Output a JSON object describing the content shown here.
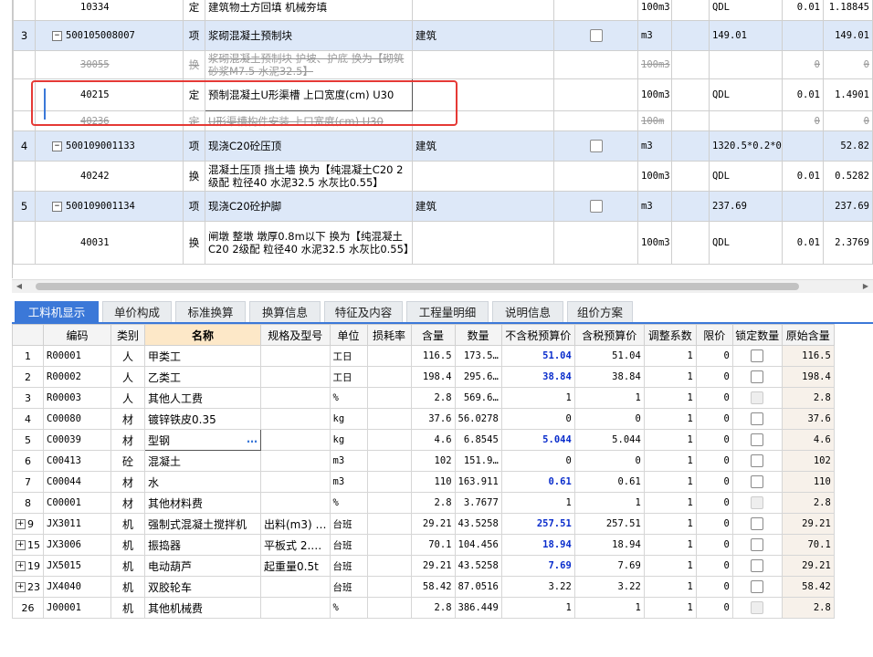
{
  "top_rows": [
    {
      "kind": "de",
      "seq": "",
      "code": "10334",
      "type": "定",
      "name": "建筑物土方回填 机械夯填",
      "spec": "",
      "unit": "100m3",
      "qty_expr": "QDL",
      "qty": "0.01",
      "total": "1.18845"
    },
    {
      "kind": "qd",
      "seq": "3",
      "code": "500105008007",
      "type": "项",
      "name": "浆砌混凝土预制块",
      "spec": "建筑",
      "unit": "m3",
      "qty_expr": "149.01",
      "qty": "",
      "total": "149.01"
    },
    {
      "kind": "strike",
      "seq": "",
      "code": "30055",
      "type": "换",
      "name": "浆砌混凝土预制块 护坡、护底  换为【砌筑砂浆M7.5 水泥32.5】",
      "spec": "",
      "unit": "100m3",
      "qty_expr": "",
      "qty": "0",
      "total": "0"
    },
    {
      "kind": "sel",
      "seq": "",
      "code": "40215",
      "type": "定",
      "name": "预制混凝土U形渠槽 上口宽度(cm) U30",
      "spec": "",
      "unit": "100m3",
      "qty_expr": "QDL",
      "qty": "0.01",
      "total": "1.4901",
      "extra": "2"
    },
    {
      "kind": "strike",
      "seq": "",
      "code": "40236",
      "type": "定",
      "name": "U形渠槽构件安装 上口宽度(cm) U30",
      "spec": "",
      "unit": "100m",
      "qty_expr": "",
      "qty": "0",
      "total": "0"
    },
    {
      "kind": "qd",
      "seq": "4",
      "code": "500109001133",
      "type": "项",
      "name": "现浇C20砼压顶",
      "spec": "建筑",
      "unit": "m3",
      "qty_expr": "1320.5*0.2*0.1*2",
      "qty": "",
      "total": "52.82"
    },
    {
      "kind": "de",
      "seq": "",
      "code": "40242",
      "type": "换",
      "name": "混凝土压顶 挡土墙  换为【纯混凝土C20 2级配 粒径40 水泥32.5 水灰比0.55】",
      "spec": "",
      "unit": "100m3",
      "qty_expr": "QDL",
      "qty": "0.01",
      "total": "0.5282",
      "extra": "4"
    },
    {
      "kind": "qd",
      "seq": "5",
      "code": "500109001134",
      "type": "项",
      "name": "现浇C20砼护脚",
      "spec": "建筑",
      "unit": "m3",
      "qty_expr": "237.69",
      "qty": "",
      "total": "237.69"
    },
    {
      "kind": "de",
      "seq": "",
      "code": "40031",
      "type": "换",
      "name": "闸墩 整墩 墩厚0.8m以下  换为【纯混凝土C20 2级配 粒径40 水泥32.5 水灰比0.55】",
      "spec": "",
      "unit": "100m3",
      "qty_expr": "QDL",
      "qty": "0.01",
      "total": "2.3769"
    }
  ],
  "tabs": [
    "工料机显示",
    "单价构成",
    "标准换算",
    "换算信息",
    "特征及内容",
    "工程量明细",
    "说明信息",
    "组价方案"
  ],
  "columns": [
    "编码",
    "类别",
    "名称",
    "规格及型号",
    "单位",
    "损耗率",
    "含量",
    "数量",
    "不含税预算价",
    "含税预算价",
    "调整系数",
    "限价",
    "锁定数量",
    "原始含量"
  ],
  "materials": [
    {
      "rn": "1",
      "expand": "",
      "code": "R00001",
      "cat": "人",
      "name": "甲类工",
      "spec": "",
      "unit": "工日",
      "loss": "",
      "content": "116.5",
      "qty": "173.5…",
      "price_ex": "51.04",
      "price_in": "51.04",
      "coef": "1",
      "limit": "0",
      "lock": "on",
      "orig": "116.5"
    },
    {
      "rn": "2",
      "expand": "",
      "code": "R00002",
      "cat": "人",
      "name": "乙类工",
      "spec": "",
      "unit": "工日",
      "loss": "",
      "content": "198.4",
      "qty": "295.6…",
      "price_ex": "38.84",
      "price_in": "38.84",
      "coef": "1",
      "limit": "0",
      "lock": "on",
      "orig": "198.4"
    },
    {
      "rn": "3",
      "expand": "",
      "code": "R00003",
      "cat": "人",
      "name": "其他人工费",
      "spec": "",
      "unit": "%",
      "loss": "",
      "content": "2.8",
      "qty": "569.6…",
      "price_ex": "1",
      "price_in": "1",
      "coef": "1",
      "limit": "0",
      "lock": "dis",
      "orig": "2.8"
    },
    {
      "rn": "4",
      "expand": "",
      "code": "C00080",
      "cat": "材",
      "name": "镀锌铁皮0.35",
      "spec": "",
      "unit": "kg",
      "loss": "",
      "content": "37.6",
      "qty": "56.0278",
      "price_ex": "0",
      "price_in": "0",
      "coef": "1",
      "limit": "0",
      "lock": "on",
      "orig": "37.6"
    },
    {
      "rn": "5",
      "expand": "",
      "code": "C00039",
      "cat": "材",
      "name": "型钢",
      "spec": "",
      "unit": "kg",
      "loss": "",
      "content": "4.6",
      "qty": "6.8545",
      "price_ex": "5.044",
      "price_in": "5.044",
      "coef": "1",
      "limit": "0",
      "lock": "on",
      "orig": "4.6"
    },
    {
      "rn": "6",
      "expand": "",
      "code": "C00413",
      "cat": "砼",
      "name": "混凝土",
      "spec": "",
      "unit": "m3",
      "loss": "",
      "content": "102",
      "qty": "151.9…",
      "price_ex": "0",
      "price_in": "0",
      "coef": "1",
      "limit": "0",
      "lock": "on",
      "orig": "102"
    },
    {
      "rn": "7",
      "expand": "",
      "code": "C00044",
      "cat": "材",
      "name": "水",
      "spec": "",
      "unit": "m3",
      "loss": "",
      "content": "110",
      "qty": "163.911",
      "price_ex": "0.61",
      "price_in": "0.61",
      "coef": "1",
      "limit": "0",
      "lock": "on",
      "orig": "110"
    },
    {
      "rn": "8",
      "expand": "",
      "code": "C00001",
      "cat": "材",
      "name": "其他材料费",
      "spec": "",
      "unit": "%",
      "loss": "",
      "content": "2.8",
      "qty": "3.7677",
      "price_ex": "1",
      "price_in": "1",
      "coef": "1",
      "limit": "0",
      "lock": "dis",
      "orig": "2.8"
    },
    {
      "rn": "9",
      "expand": "+",
      "code": "JX3011",
      "cat": "机",
      "name": "强制式混凝土搅拌机",
      "spec": "出料(m3) …",
      "unit": "台班",
      "loss": "",
      "content": "29.21",
      "qty": "43.5258",
      "price_ex": "257.51",
      "price_in": "257.51",
      "coef": "1",
      "limit": "0",
      "lock": "on",
      "orig": "29.21"
    },
    {
      "rn": "15",
      "expand": "+",
      "code": "JX3006",
      "cat": "机",
      "name": "振捣器",
      "spec": "平板式 2.…",
      "unit": "台班",
      "loss": "",
      "content": "70.1",
      "qty": "104.456",
      "price_ex": "18.94",
      "price_in": "18.94",
      "coef": "1",
      "limit": "0",
      "lock": "on",
      "orig": "70.1"
    },
    {
      "rn": "19",
      "expand": "+",
      "code": "JX5015",
      "cat": "机",
      "name": "电动葫芦",
      "spec": "起重量0.5t",
      "unit": "台班",
      "loss": "",
      "content": "29.21",
      "qty": "43.5258",
      "price_ex": "7.69",
      "price_in": "7.69",
      "coef": "1",
      "limit": "0",
      "lock": "on",
      "orig": "29.21"
    },
    {
      "rn": "23",
      "expand": "+",
      "code": "JX4040",
      "cat": "机",
      "name": "双胶轮车",
      "spec": "",
      "unit": "台班",
      "loss": "",
      "content": "58.42",
      "qty": "87.0516",
      "price_ex": "3.22",
      "price_in": "3.22",
      "coef": "1",
      "limit": "0",
      "lock": "on",
      "orig": "58.42"
    },
    {
      "rn": "26",
      "expand": "",
      "code": "J00001",
      "cat": "机",
      "name": "其他机械费",
      "spec": "",
      "unit": "%",
      "loss": "",
      "content": "2.8",
      "qty": "386.449",
      "price_ex": "1",
      "price_in": "1",
      "coef": "1",
      "limit": "0",
      "lock": "dis",
      "orig": "2.8"
    }
  ],
  "blue_price_rows": [
    "1",
    "2",
    "5",
    "7",
    "9",
    "15",
    "19"
  ],
  "editing_cell": {
    "row": "5",
    "field": "name",
    "ellipsis": "…"
  },
  "colors": {
    "accent": "#3b78d8",
    "highlight": "#e53935",
    "qd_row": "#dde8f8",
    "price_blue": "#0a2dcc"
  }
}
